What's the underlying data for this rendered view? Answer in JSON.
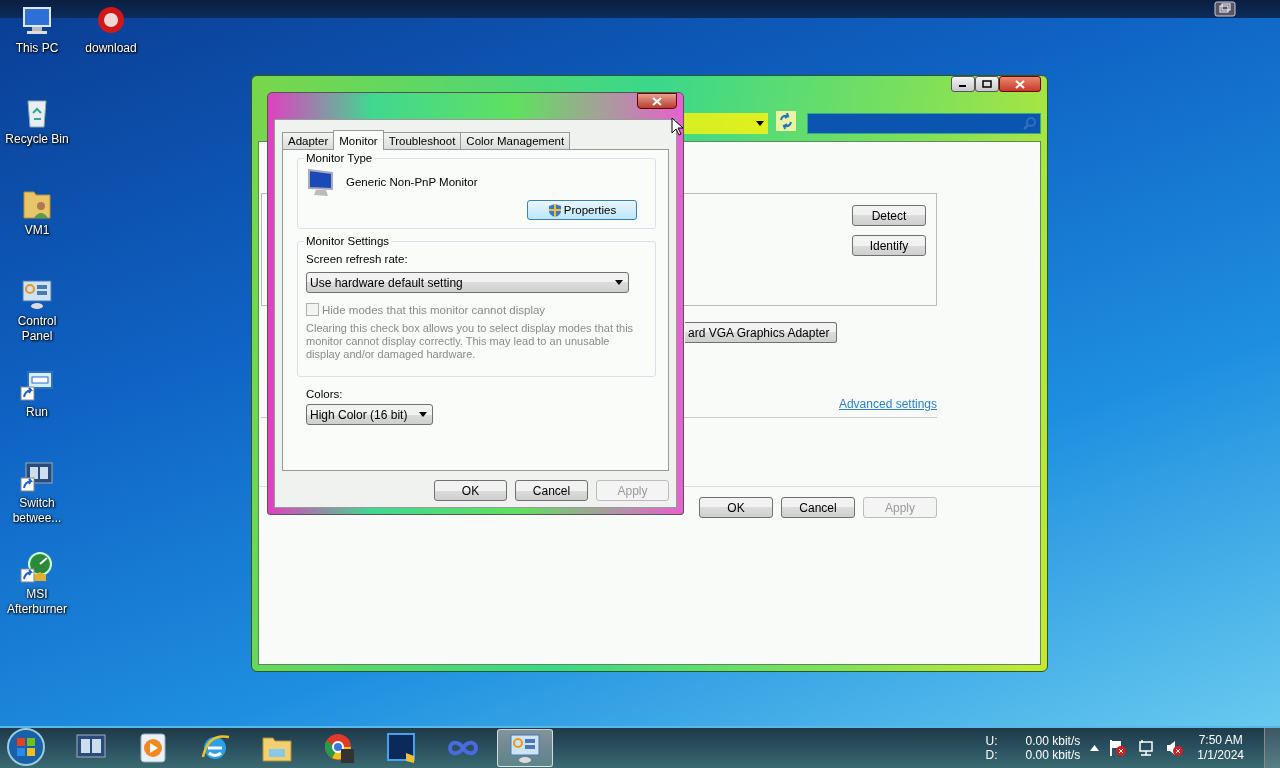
{
  "desktop_icons": [
    {
      "label": "This PC",
      "kind": "pc"
    },
    {
      "label": "download",
      "kind": "download"
    },
    {
      "label": "Recycle Bin",
      "kind": "bin"
    },
    {
      "label": "VM1",
      "kind": "folder"
    },
    {
      "label": "Control Panel",
      "kind": "control"
    },
    {
      "label": "Run",
      "kind": "run"
    },
    {
      "label": "Switch betwee...",
      "kind": "switch"
    },
    {
      "label": "MSI Afterburner",
      "kind": "msi"
    }
  ],
  "back_window": {
    "buttons": [
      "Detect",
      "Identify"
    ],
    "adapter_dropdown": "ard VGA Graphics Adapter",
    "advanced_link": "Advanced settings",
    "footer_buttons": [
      {
        "label": "OK",
        "disabled": false
      },
      {
        "label": "Cancel",
        "disabled": false
      },
      {
        "label": "Apply",
        "disabled": true
      }
    ]
  },
  "dialog": {
    "tabs": [
      {
        "label": "Adapter",
        "selected": false
      },
      {
        "label": "Monitor",
        "selected": true
      },
      {
        "label": "Troubleshoot",
        "selected": false
      },
      {
        "label": "Color Management",
        "selected": false
      }
    ],
    "monitor_type": {
      "title": "Monitor Type",
      "name": "Generic Non-PnP Monitor",
      "button": "Properties"
    },
    "monitor_settings": {
      "title": "Monitor Settings",
      "refresh_label": "Screen refresh rate:",
      "refresh_value": "Use hardware default setting",
      "hide_modes": {
        "label": "Hide modes that this monitor cannot display",
        "checked": false,
        "disabled": true
      },
      "note": "Clearing this check box allows you to select display modes that this monitor cannot display correctly. This may lead to an unusable display and/or damaged hardware."
    },
    "colors": {
      "label": "Colors:",
      "value": "High Color (16 bit)"
    },
    "buttons": [
      {
        "label": "OK",
        "disabled": false
      },
      {
        "label": "Cancel",
        "disabled": false
      },
      {
        "label": "Apply",
        "disabled": true
      }
    ]
  },
  "taskbar": {
    "apps": [
      {
        "kind": "switch",
        "selected": false
      },
      {
        "kind": "media",
        "selected": false
      },
      {
        "kind": "ie",
        "selected": false
      },
      {
        "kind": "explorer",
        "selected": false
      },
      {
        "kind": "chrome",
        "selected": false
      },
      {
        "kind": "photoshop",
        "selected": false
      },
      {
        "kind": "infinity",
        "selected": false
      },
      {
        "kind": "control",
        "selected": true
      }
    ],
    "network": [
      {
        "label": "U:",
        "value": "0.00 kbit/s"
      },
      {
        "label": "D:",
        "value": "0.00 kbit/s"
      }
    ],
    "clock": {
      "time": "7:50 AM",
      "date": "1/1/2024"
    }
  }
}
